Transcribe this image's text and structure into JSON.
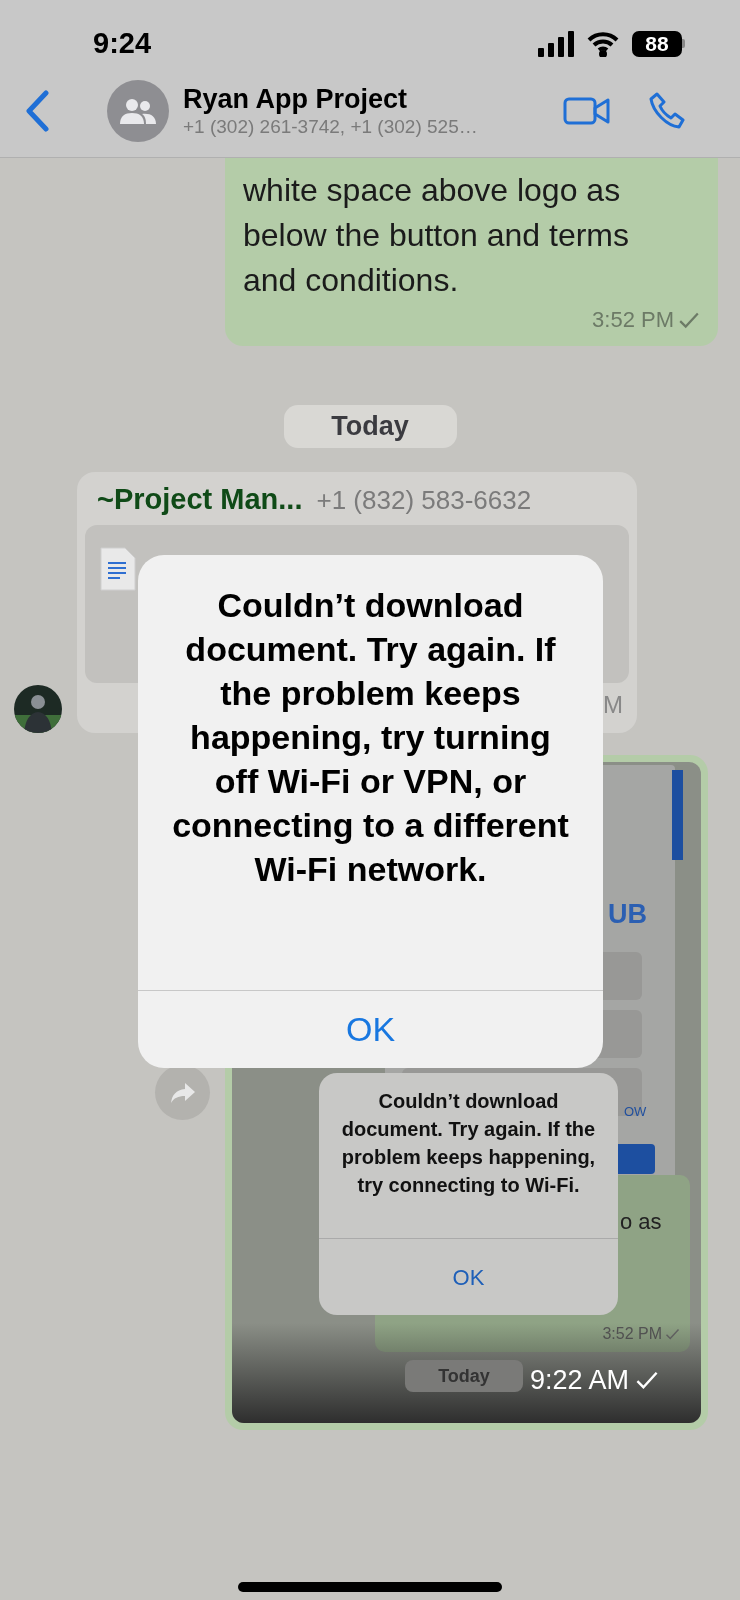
{
  "status_bar": {
    "time": "9:24",
    "battery": "88"
  },
  "header": {
    "title": "Ryan App Project",
    "subtitle": "+1 (302) 261-3742, +1 (302) 525…"
  },
  "messages": [
    {
      "kind": "outgoing_text",
      "text": "white space above logo as below the button and terms and conditions.",
      "time": "3:52 PM"
    },
    {
      "kind": "date",
      "text": "Today"
    },
    {
      "kind": "incoming_document",
      "sender": "~Project Man...",
      "phone": "+1 (832) 583-6632",
      "time": "M"
    },
    {
      "kind": "outgoing_image",
      "time": "9:22 AM",
      "screenshot": {
        "heading": "UB",
        "link": "OW",
        "bubble_text": "o as",
        "bubble_time": "3:52 PM",
        "date": "Today",
        "alert": {
          "message": "Couldn’t download document. Try again. If the problem keeps happening, try connecting to Wi-Fi.",
          "button": "OK"
        }
      }
    }
  ],
  "alert": {
    "message": "Couldn’t download document. Try again. If the problem keeps happening, try turning off Wi-Fi or VPN, or connecting to a different Wi-Fi network.",
    "button": "OK"
  }
}
